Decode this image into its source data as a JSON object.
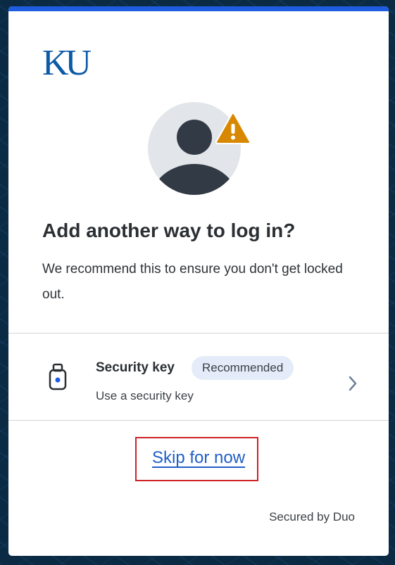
{
  "brand": {
    "logo_text": "KU",
    "accent_color": "#1f5de0",
    "logo_color": "#0c5aa6"
  },
  "icons": {
    "avatar": "user-avatar-icon",
    "warning": "warning-icon",
    "security_key": "security-key-icon",
    "chevron": "chevron-right-icon"
  },
  "main": {
    "title": "Add another way to log in?",
    "description": "We recommend this to ensure you don't get locked out."
  },
  "method": {
    "title": "Security key",
    "badge": "Recommended",
    "description": "Use a security key"
  },
  "actions": {
    "skip_label": "Skip for now"
  },
  "footer": {
    "secured_by": "Secured by Duo"
  }
}
